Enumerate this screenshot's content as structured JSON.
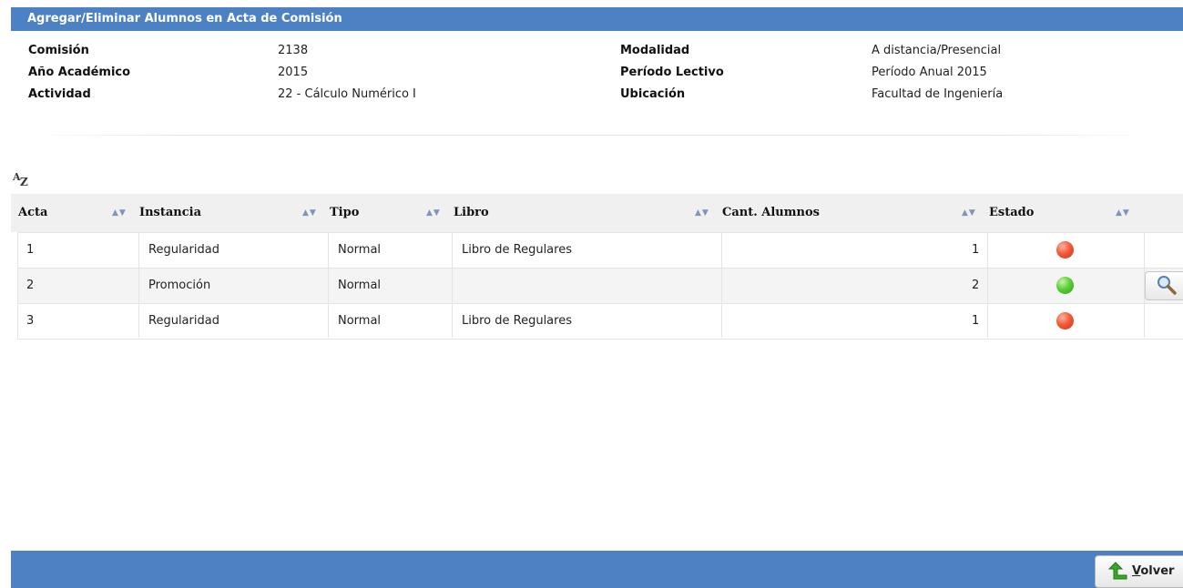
{
  "window": {
    "title": "Agregar/Eliminar Alumnos en Acta de Comisión"
  },
  "info": {
    "left": [
      {
        "label": "Comisión",
        "value": "2138"
      },
      {
        "label": "Año Académico",
        "value": "2015"
      },
      {
        "label": "Actividad",
        "value": "22 - Cálculo Numérico I"
      }
    ],
    "right": [
      {
        "label": "Modalidad",
        "value": "A distancia/Presencial"
      },
      {
        "label": "Período Lectivo",
        "value": "Período Anual 2015"
      },
      {
        "label": "Ubicación",
        "value": "Facultad de Ingeniería"
      }
    ]
  },
  "sort_icon": {
    "a": "A",
    "z": "Z",
    "icon": "sort-az-icon"
  },
  "table": {
    "columns": [
      "Acta",
      "Instancia",
      "Tipo",
      "Libro",
      "Cant. Alumnos",
      "Estado"
    ],
    "sort_glyph": "▲▼",
    "rows": [
      {
        "acta": "1",
        "instancia": "Regularidad",
        "tipo": "Normal",
        "libro": "Libro de Regulares",
        "cant": "1",
        "estado": "red"
      },
      {
        "acta": "2",
        "instancia": "Promoción",
        "tipo": "Normal",
        "libro": "",
        "cant": "2",
        "estado": "green"
      },
      {
        "acta": "3",
        "instancia": "Regularidad",
        "tipo": "Normal",
        "libro": "Libro de Regulares",
        "cant": "1",
        "estado": "red"
      }
    ],
    "colors": {
      "red": "#f35a3a",
      "green": "#5ccf3a"
    }
  },
  "footer": {
    "volver_first": "V",
    "volver_rest": "olver",
    "icon": "green-arrow-back-icon"
  },
  "colors": {
    "header_blue": "#4c82c3"
  }
}
